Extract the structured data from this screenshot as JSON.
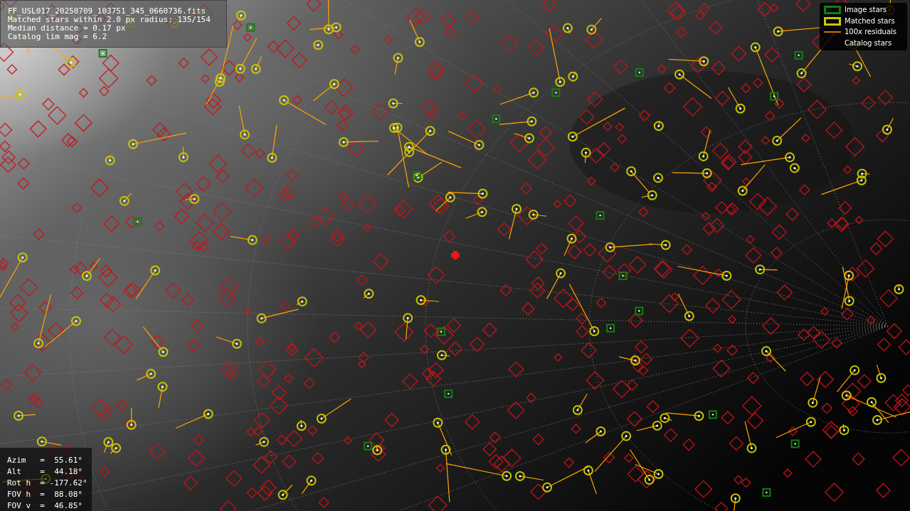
{
  "info_box": {
    "lines": [
      "FF_USL017_20250709_103751_345_0660736.fits",
      "Matched stars within 2.0 px radius: 135/154",
      "Median distance = 0.17 px",
      "Catalog lim mag = 6.2"
    ]
  },
  "legend": {
    "items": [
      {
        "label": "Image stars"
      },
      {
        "label": "Matched stars",
        "kind": "matched"
      },
      {
        "label": "100x residuals",
        "kind": "residual"
      },
      {
        "label": "Catalog stars",
        "kind": "catalog"
      }
    ]
  },
  "pointing_box": {
    "lines": [
      "Azim   =  55.61°",
      "Alt    =  44.18°",
      "Rot h  = -177.62°",
      "FOV h  =  88.08°",
      "FOV v  =  46.85°"
    ]
  }
}
